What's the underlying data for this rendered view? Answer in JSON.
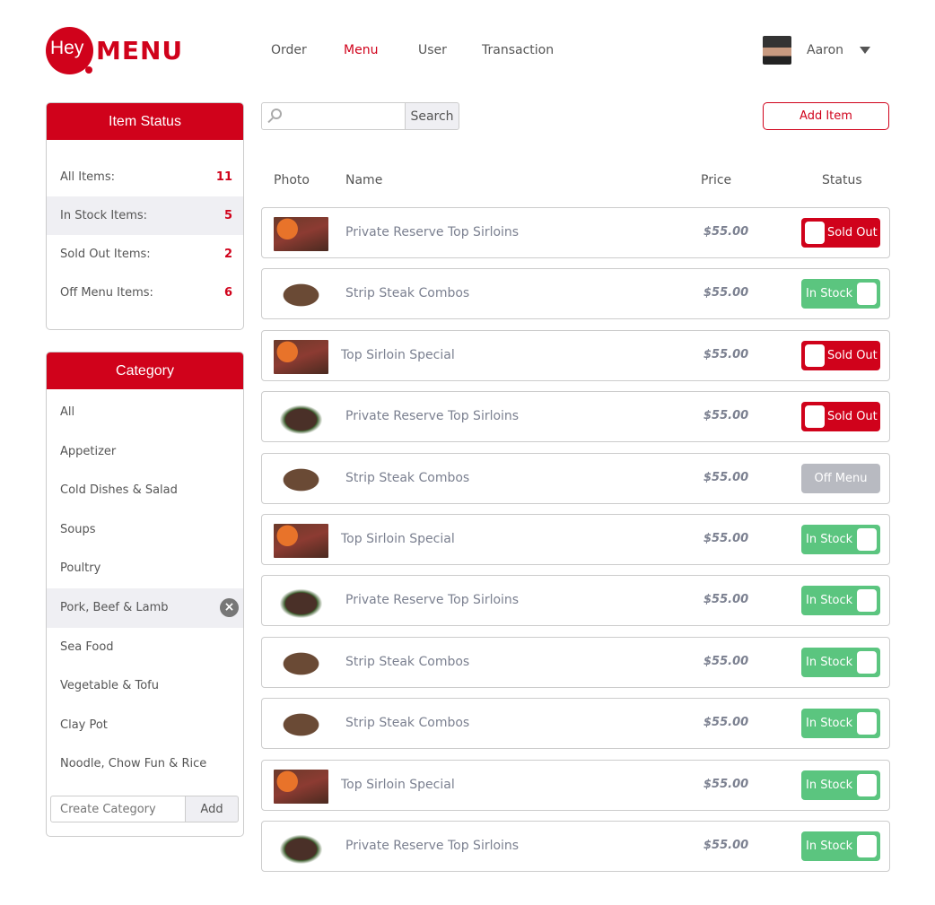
{
  "brand": {
    "hey": "Hey",
    "menu": "MENU"
  },
  "nav": [
    {
      "label": "Order"
    },
    {
      "label": "Menu",
      "active": true
    },
    {
      "label": "User"
    },
    {
      "label": "Transaction"
    }
  ],
  "user": {
    "name": "Aaron"
  },
  "item_status": {
    "title": "Item Status",
    "rows": [
      {
        "label": "All Items:",
        "count": "11"
      },
      {
        "label": "In Stock Items:",
        "count": "5"
      },
      {
        "label": "Sold Out Items:",
        "count": "2"
      },
      {
        "label": "Off Menu Items:",
        "count": "6"
      }
    ]
  },
  "category": {
    "title": "Category",
    "items": [
      "All",
      "Appetizer",
      "Cold Dishes & Salad",
      "Soups",
      "Poultry",
      "Pork, Beef & Lamb",
      "Sea Food",
      "Vegetable & Tofu",
      "Clay Pot",
      "Noodle, Chow Fun & Rice"
    ],
    "selected": "Pork, Beef & Lamb",
    "create_placeholder": "Create Category",
    "add_label": "Add"
  },
  "search": {
    "value": "",
    "button": "Search"
  },
  "add_item": "Add Item",
  "table": {
    "headers": {
      "photo": "Photo",
      "name": "Name",
      "price": "Price",
      "status": "Status"
    },
    "rows": [
      {
        "name": "Private Reserve Top Sirloins",
        "price": "$55.00",
        "status": "Sold Out",
        "photo": "p1"
      },
      {
        "name": "Strip Steak Combos",
        "price": "$55.00",
        "status": "In Stock",
        "photo": "p2"
      },
      {
        "name": "Top Sirloin Special",
        "price": "$55.00",
        "status": "Sold Out",
        "photo": "p1"
      },
      {
        "name": "Private Reserve Top Sirloins",
        "price": "$55.00",
        "status": "Sold Out",
        "photo": "p3"
      },
      {
        "name": "Strip Steak Combos",
        "price": "$55.00",
        "status": "Off Menu",
        "photo": "p2"
      },
      {
        "name": "Top Sirloin Special",
        "price": "$55.00",
        "status": "In Stock",
        "photo": "p1"
      },
      {
        "name": "Private Reserve Top Sirloins",
        "price": "$55.00",
        "status": "In Stock",
        "photo": "p3"
      },
      {
        "name": "Strip Steak Combos",
        "price": "$55.00",
        "status": "In Stock",
        "photo": "p2"
      },
      {
        "name": "Strip Steak Combos",
        "price": "$55.00",
        "status": "In Stock",
        "photo": "p2"
      },
      {
        "name": "Top Sirloin Special",
        "price": "$55.00",
        "status": "In Stock",
        "photo": "p1"
      },
      {
        "name": "Private Reserve Top Sirloins",
        "price": "$55.00",
        "status": "In Stock",
        "photo": "p3"
      }
    ]
  },
  "colors": {
    "accent": "#d0021b",
    "in_stock": "#5bc57f",
    "off_menu": "#b8bac1"
  }
}
